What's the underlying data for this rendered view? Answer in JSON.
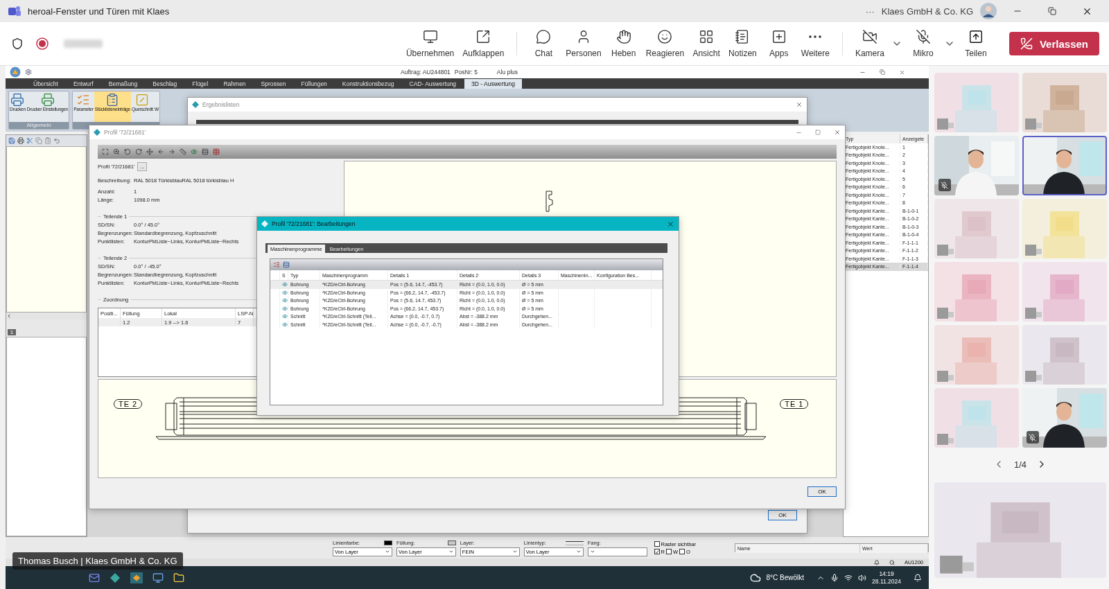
{
  "teams": {
    "title": "heroal-Fenster und Türen mit Klaes",
    "more": "···",
    "account": "Klaes GmbH & Co. KG",
    "recording": true,
    "actions": [
      {
        "kind": "takeover",
        "label": "Übernehmen"
      },
      {
        "kind": "popout",
        "label": "Aufklappen"
      },
      {
        "kind": "chat",
        "label": "Chat"
      },
      {
        "kind": "people",
        "label": "Personen"
      },
      {
        "kind": "hand",
        "label": "Heben"
      },
      {
        "kind": "react",
        "label": "Reagieren"
      },
      {
        "kind": "view",
        "label": "Ansicht"
      },
      {
        "kind": "notes",
        "label": "Notizen"
      },
      {
        "kind": "apps",
        "label": "Apps"
      },
      {
        "kind": "more",
        "label": "Weitere"
      }
    ],
    "devices": [
      {
        "kind": "camera",
        "label": "Kamera",
        "on": false
      },
      {
        "kind": "mic",
        "label": "Mikro",
        "on": false
      },
      {
        "kind": "share",
        "label": "Teilen"
      }
    ],
    "leave": "Verlassen"
  },
  "cad": {
    "header": {
      "order": "Auftrag: AU244801",
      "position": "PosNr: 5",
      "series": "Alu plus"
    },
    "tabs": [
      {
        "label": "Übersicht",
        "selected": false
      },
      {
        "label": "Entwurf",
        "selected": false
      },
      {
        "label": "Bemaßung",
        "selected": false
      },
      {
        "label": "Beschlag",
        "selected": false
      },
      {
        "label": "Flügel",
        "selected": false
      },
      {
        "label": "Rahmen",
        "selected": false
      },
      {
        "label": "Sprossen",
        "selected": false
      },
      {
        "label": "Füllungen",
        "selected": false
      },
      {
        "label": "Konstruktionsbezug",
        "selected": false
      },
      {
        "label": "CAD- Auswertung",
        "selected": false
      },
      {
        "label": "3D - Auswertung",
        "selected": true
      }
    ],
    "ribbon": [
      {
        "label": "Allgemein",
        "buttons": [
          {
            "kind": "print",
            "label": "Drucken",
            "selected": false
          },
          {
            "kind": "printer-settings",
            "label": "Drucker Einstellungen",
            "selected": false
          }
        ]
      },
      {
        "buttons": [
          {
            "kind": "parameter",
            "label": "Parameter",
            "selected": false
          },
          {
            "kind": "parts",
            "label": "Stücklisteneinträge",
            "selected": true
          },
          {
            "kind": "section",
            "label": "Querschnitt",
            "selected": false
          },
          {
            "kind": "cut",
            "label": "W",
            "selected": false
          }
        ]
      }
    ],
    "left_tab": "1",
    "results_window": {
      "title": "Ergebnislisten",
      "ok": "OK"
    },
    "objects_list": {
      "columns": [
        "Typ",
        "Anzeigete"
      ],
      "rows": [
        {
          "cells": [
            "Fertigobjekt Knote...",
            "1"
          ],
          "selected": false
        },
        {
          "cells": [
            "Fertigobjekt Knote...",
            "2"
          ],
          "selected": false
        },
        {
          "cells": [
            "Fertigobjekt Knote...",
            "3"
          ],
          "selected": false
        },
        {
          "cells": [
            "Fertigobjekt Knote...",
            "4"
          ],
          "selected": false
        },
        {
          "cells": [
            "Fertigobjekt Knote...",
            "5"
          ],
          "selected": false
        },
        {
          "cells": [
            "Fertigobjekt Knote...",
            "6"
          ],
          "selected": false
        },
        {
          "cells": [
            "Fertigobjekt Knote...",
            "7"
          ],
          "selected": false
        },
        {
          "cells": [
            "Fertigobjekt Knote...",
            "8"
          ],
          "selected": false
        },
        {
          "cells": [
            "Fertigobjekt Kante...",
            "B-1-0-1"
          ],
          "selected": false
        },
        {
          "cells": [
            "Fertigobjekt Kante...",
            "B-1-0-2"
          ],
          "selected": false
        },
        {
          "cells": [
            "Fertigobjekt Kante...",
            "B-1-0-3"
          ],
          "selected": false
        },
        {
          "cells": [
            "Fertigobjekt Kante...",
            "B-1-0-4"
          ],
          "selected": false
        },
        {
          "cells": [
            "Fertigobjekt Kante...",
            "F-1-1-1"
          ],
          "selected": false
        },
        {
          "cells": [
            "Fertigobjekt Kante...",
            "F-1-1-2"
          ],
          "selected": false
        },
        {
          "cells": [
            "Fertigobjekt Kante...",
            "F-1-1-3"
          ],
          "selected": false
        },
        {
          "cells": [
            "Fertigobjekt Kante...",
            "F-1-1-4"
          ],
          "selected": true
        }
      ]
    },
    "profile_window": {
      "title": "Profil '72/21681'",
      "profile": "Profil '72/21681'",
      "browse": "...",
      "fields": [
        {
          "label": "Beschreibung:",
          "value": "RAL 5018 TürkisblauRAL 5018 türkisblau H"
        },
        {
          "label": "Anzahl:",
          "value": "1"
        },
        {
          "label": "Länge:",
          "value": "1098.0 mm"
        }
      ],
      "part_ends": [
        {
          "title": "Teilende 1",
          "fields": [
            {
              "label": "SD/SN:",
              "value": "0.0° / 45.0°"
            },
            {
              "label": "Begrenzungen:",
              "value": "Standardbegrenzung, Kopfzuschnitt"
            },
            {
              "label": "Punktlisten:",
              "value": "KonturPktListe~Links, KonturPktListe~Rechts"
            }
          ]
        },
        {
          "title": "Teilende 2",
          "fields": [
            {
              "label": "SD/SN:",
              "value": "0.0° / -45.0°"
            },
            {
              "label": "Begrenzungen:",
              "value": "Standardbegrenzung, Kopfzuschnitt"
            },
            {
              "label": "Punktlisten:",
              "value": "KonturPktListe~Links, KonturPktListe~Rechts"
            }
          ]
        }
      ],
      "assignment": {
        "title": "Zuordnung",
        "columns": [
          "Positi...",
          "Füllung",
          "Lokal",
          "LSP-N"
        ],
        "rows": [
          {
            "cells": [
              "",
              "1.2",
              "1.9 --> 1.6",
              "7"
            ]
          }
        ]
      },
      "end_labels": [
        "TE 2",
        "TE 1"
      ],
      "ok": "OK"
    },
    "machining_dialog": {
      "title": "Profil '72/21681': Bearbeitungen",
      "tabs": [
        {
          "label": "Maschinenprogramme",
          "selected": true
        },
        {
          "label": "Bearbeitungen",
          "selected": false
        }
      ],
      "columns": [
        "S",
        "Typ",
        "Maschinenprogramm",
        "Details 1",
        "Details 2",
        "Details 3",
        "MaschinenIn...",
        "Konfiguration Bes..."
      ],
      "rows": [
        {
          "visible": true,
          "selected": true,
          "cells": [
            "",
            "Bohrung",
            "*K2D/eCtrl-Bohrung",
            "Pos = (5.6, 14.7, -453.7)",
            "Richt = (0.0, 1.0, 0.0)",
            "Ø = 5 mm"
          ]
        },
        {
          "visible": true,
          "selected": false,
          "cells": [
            "",
            "Bohrung",
            "*K2D/eCtrl-Bohrung",
            "Pos = (66.2, 14.7, -453.7)",
            "Richt = (0.0, 1.0, 0.0)",
            "Ø = 5 mm"
          ]
        },
        {
          "visible": true,
          "selected": false,
          "cells": [
            "",
            "Bohrung",
            "*K2D/eCtrl-Bohrung",
            "Pos = (5.6, 14.7, 453.7)",
            "Richt = (0.0, 1.0, 0.0)",
            "Ø = 5 mm"
          ]
        },
        {
          "visible": true,
          "selected": false,
          "cells": [
            "",
            "Bohrung",
            "*K2D/eCtrl-Bohrung",
            "Pos = (66.2, 14.7, 453.7)",
            "Richt = (0.0, 1.0, 0.0)",
            "Ø = 5 mm"
          ]
        },
        {
          "visible": true,
          "selected": false,
          "cells": [
            "",
            "Schnitt",
            "*K2D/eCtrl-Schnitt (Teil...",
            "Achse = (0.0, -0.7, 0.7)",
            "Abst = -388.2 mm",
            "Durchgehen..."
          ]
        },
        {
          "visible": true,
          "selected": false,
          "cells": [
            "",
            "Schnitt",
            "*K2D/eCtrl-Schnitt (Teil...",
            "Achse = (0.0, -0.7, -0.7)",
            "Abst = -388.2 mm",
            "Durchgehen..."
          ]
        }
      ]
    },
    "properties": {
      "fields": [
        {
          "kind": "color",
          "label": "Linienfarbe:",
          "value": "Von Layer",
          "color": "#000000"
        },
        {
          "kind": "color",
          "label": "Füllung:",
          "value": "Von Layer",
          "color": "#c8c8c8"
        },
        {
          "kind": "plain",
          "label": "Layer:",
          "value": "FEIN"
        },
        {
          "kind": "linetype",
          "label": "Linientyp:",
          "value": "Von Layer"
        },
        {
          "kind": "plain",
          "label": "Fang:"
        }
      ],
      "grid": {
        "label": "Raster sichtbar",
        "checked": false,
        "options": [
          {
            "label": "R",
            "checked": true
          },
          {
            "label": "W",
            "checked": false
          },
          {
            "label": "O",
            "checked": false
          }
        ]
      },
      "list_columns": [
        "Name",
        "Wert"
      ]
    },
    "status": "AU1200"
  },
  "taskbar": {
    "speaker": "Thomas Busch | Klaes GmbH & Co. KG",
    "weather": "8°C  Bewölkt",
    "time": "14:19",
    "date": "28.11.2024"
  },
  "gallery": {
    "tiles": [
      {
        "kind": "blurred"
      },
      {
        "kind": "blurred"
      },
      {
        "kind": "person",
        "muted": true,
        "speaking": false
      },
      {
        "kind": "person",
        "muted": false,
        "speaking": true
      },
      {
        "kind": "blurred"
      },
      {
        "kind": "blurred"
      },
      {
        "kind": "blurred"
      },
      {
        "kind": "blurred"
      },
      {
        "kind": "blurred"
      },
      {
        "kind": "blurred"
      },
      {
        "kind": "blurred"
      },
      {
        "kind": "person",
        "muted": true,
        "speaking": false
      }
    ],
    "pager": "1/4",
    "featured": {
      "kind": "blurred"
    }
  }
}
